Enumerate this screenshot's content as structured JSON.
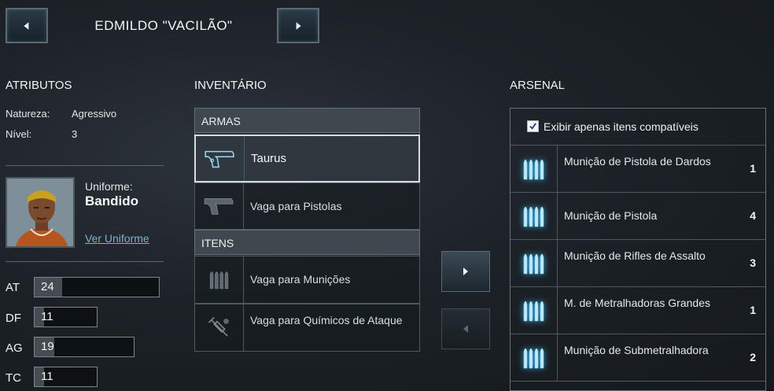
{
  "header": {
    "character_name": "EDMILDO \"VACILÃO\"",
    "prev_icon": "arrow-left-icon",
    "next_icon": "arrow-right-icon"
  },
  "attributes": {
    "title": "ATRIBUTOS",
    "nature_label": "Natureza:",
    "nature_value": "Agressivo",
    "level_label": "Nível:",
    "level_value": "3"
  },
  "uniform": {
    "label": "Uniforme:",
    "value": "Bandido",
    "link": "Ver Uniforme"
  },
  "stats": [
    {
      "label": "AT",
      "value": "24",
      "fill": 0.22
    },
    {
      "label": "DF",
      "value": "11",
      "fill": 0.15
    },
    {
      "label": "AG",
      "value": "19",
      "fill": 0.2
    },
    {
      "label": "TC",
      "value": "11",
      "fill": 0.15
    }
  ],
  "inventory": {
    "title": "INVENTÁRIO",
    "weapons_header": "ARMAS",
    "items_header": "ITENS",
    "slots": [
      {
        "label": "Taurus",
        "icon": "pistol-icon",
        "selected": true
      },
      {
        "label": "Vaga para Pistolas",
        "icon": "pistol-icon",
        "selected": false
      },
      {
        "label": "Vaga para Munições",
        "icon": "ammo-icon",
        "selected": false
      },
      {
        "label": "Vaga para Químicos de Ataque",
        "icon": "syringe-icon",
        "selected": false
      }
    ]
  },
  "transfer": {
    "move_right_icon": "arrow-right-icon",
    "move_left_icon": "arrow-left-icon"
  },
  "arsenal": {
    "title": "ARSENAL",
    "filter_label": "Exibir apenas itens compatíveis",
    "filter_checked": true,
    "items": [
      {
        "name": "Munição de Pistola de Dardos",
        "count": "1"
      },
      {
        "name": "Munição de Pistola",
        "count": "4"
      },
      {
        "name": "Munição de Rifles de Assalto",
        "count": "3"
      },
      {
        "name": "M. de Metralhadoras Grandes",
        "count": "1"
      },
      {
        "name": "Munição de Submetralhadora",
        "count": "2"
      }
    ]
  },
  "colors": {
    "accent_glow": "#36a9e0",
    "link": "#7fb1cc"
  }
}
